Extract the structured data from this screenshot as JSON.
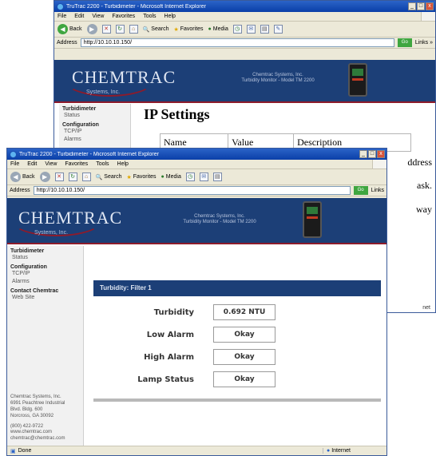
{
  "back_window": {
    "title": "TruTrac 2200 - Turbidimeter - Microsoft Internet Explorer",
    "menu": [
      "File",
      "Edit",
      "View",
      "Favorites",
      "Tools",
      "Help"
    ],
    "toolbar": {
      "back": "Back",
      "search": "Search",
      "favorites": "Favorites",
      "media": "Media"
    },
    "address_label": "Address",
    "address": "http://10.10.10.150/",
    "go": "Go",
    "links": "Links »",
    "logo": "CHEMTRAC",
    "logo_sub": "Systems, Inc.",
    "banner_text": [
      "Chemtrac Systems, Inc.",
      "Turbidity Monitor - Model TM 2200"
    ],
    "sidebar": {
      "groups": [
        {
          "title": "Turbidimeter",
          "items": [
            "Status"
          ]
        },
        {
          "title": "Configuration",
          "items": [
            "TCP/IP",
            "Alarms"
          ]
        }
      ]
    },
    "page_title": "IP Settings",
    "table_headers": [
      "Name",
      "Value",
      "Description"
    ],
    "right_fragments": [
      "ddress",
      "ask.",
      "way"
    ],
    "status_right": "net"
  },
  "front_window": {
    "title": "TruTrac 2200 - Turbidimeter - Microsoft Internet Explorer",
    "menu": [
      "File",
      "Edit",
      "View",
      "Favorites",
      "Tools",
      "Help"
    ],
    "toolbar": {
      "back": "Back",
      "search": "Search",
      "favorites": "Favorites",
      "media": "Media"
    },
    "address_label": "Address",
    "address": "http://10.10.10.150/",
    "go": "Go",
    "links": "Links",
    "logo": "CHEMTRAC",
    "logo_sub": "Systems, Inc.",
    "banner_text": [
      "Chemtrac Systems, Inc.",
      "Turbidity Monitor - Model TM 2200"
    ],
    "sidebar": {
      "groups": [
        {
          "title": "Turbidimeter",
          "items": [
            "Status"
          ]
        },
        {
          "title": "Configuration",
          "items": [
            "TCP/IP",
            "Alarms"
          ]
        },
        {
          "title": "Contact Chemtrac",
          "items": [
            "Web Site"
          ]
        }
      ]
    },
    "address_block": [
      "Chemtrac Systems, Inc.",
      "6991 Peachtree Industrial",
      "Blvd. Bldg. 600",
      "Norcross, GA 30092",
      "",
      "(800) 422-9722",
      "www.chemtrac.com",
      "chemtrac@chemtrac.com"
    ],
    "filter": {
      "heading": "Turbidity: Filter 1",
      "rows": [
        {
          "label": "Turbidity",
          "value": "0.692 NTU"
        },
        {
          "label": "Low Alarm",
          "value": "Okay"
        },
        {
          "label": "High Alarm",
          "value": "Okay"
        },
        {
          "label": "Lamp Status",
          "value": "Okay"
        }
      ]
    },
    "status": "Done",
    "zone": "Internet"
  }
}
